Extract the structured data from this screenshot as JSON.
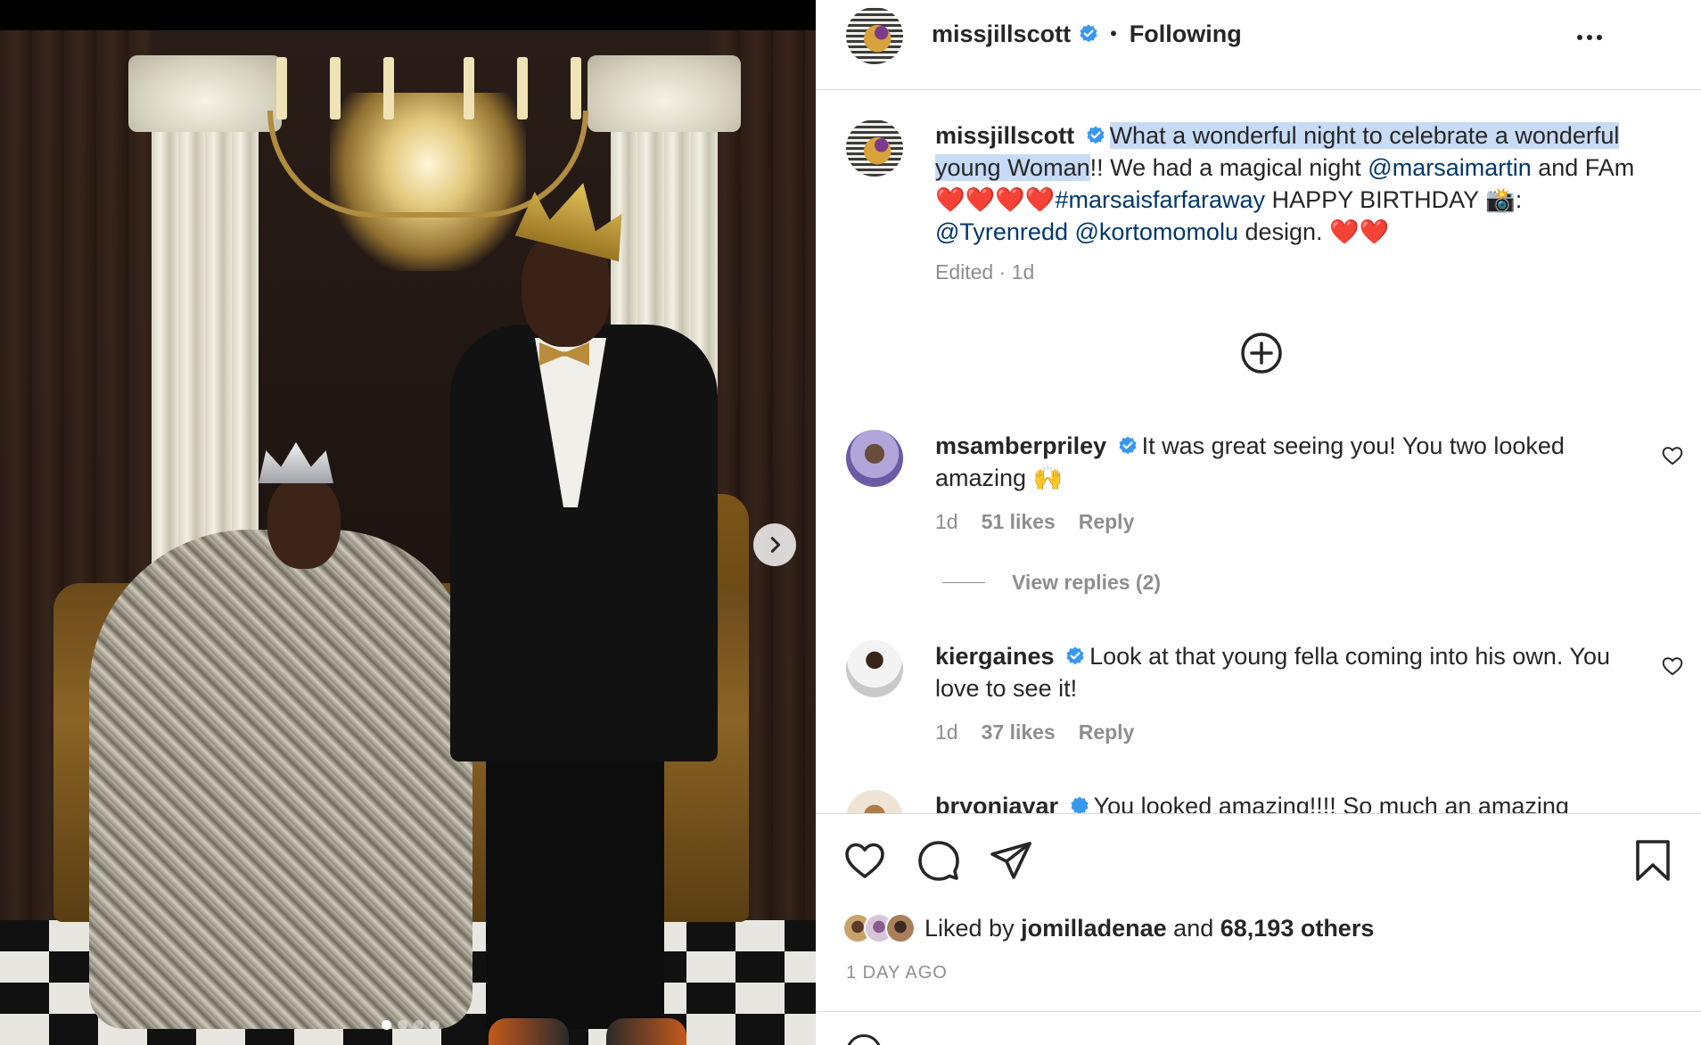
{
  "post": {
    "owner": "missjillscott",
    "follow_status": "Following",
    "header_separator": "•",
    "caption": {
      "highlighted": "What a wonderful night to celebrate a wonderful young Woman",
      "part1": "!! We had a magical night ",
      "mention1": "@marsaimartin",
      "part2": " and FAm ❤️❤️❤️❤️",
      "hashtag": "#marsaisfarfaraway",
      "part3": " HAPPY BIRTHDAY 📸: ",
      "mention2": "@Tyrenredd",
      "part4": " ",
      "mention3": "@kortomomolu",
      "part5": " design. ❤️❤️"
    },
    "caption_meta": "Edited · 1d",
    "carousel": {
      "total": 4,
      "active": 0
    }
  },
  "comments": [
    {
      "user": "msamberpriley",
      "text": "It was great seeing you! You two looked amazing 🙌",
      "time": "1d",
      "likes": "51 likes",
      "reply_label": "Reply",
      "view_replies": "View replies (2)"
    },
    {
      "user": "kiergaines",
      "text": "Look at that young fella coming into his own. You love to see it!",
      "time": "1d",
      "likes": "37 likes",
      "reply_label": "Reply"
    },
    {
      "user": "bryonjavar",
      "text": "You looked amazing!!!! So much an amazing"
    }
  ],
  "likes": {
    "prefix": "Liked by",
    "first_user": "jomilladenae",
    "connector": "and",
    "others": "68,193 others"
  },
  "timestamp": "1 DAY AGO",
  "icons": {
    "verified": "verified-badge-icon",
    "more": "more-options-icon",
    "next": "chevron-right-icon",
    "load_more": "plus-circle-icon",
    "like": "heart-icon",
    "comment": "comment-bubble-icon",
    "share": "paper-plane-icon",
    "save": "bookmark-icon"
  },
  "colors": {
    "verified": "#3897f0",
    "link": "#00376b",
    "highlight": "#c7dbf7",
    "muted": "#8e8e8e",
    "text": "#262626"
  }
}
